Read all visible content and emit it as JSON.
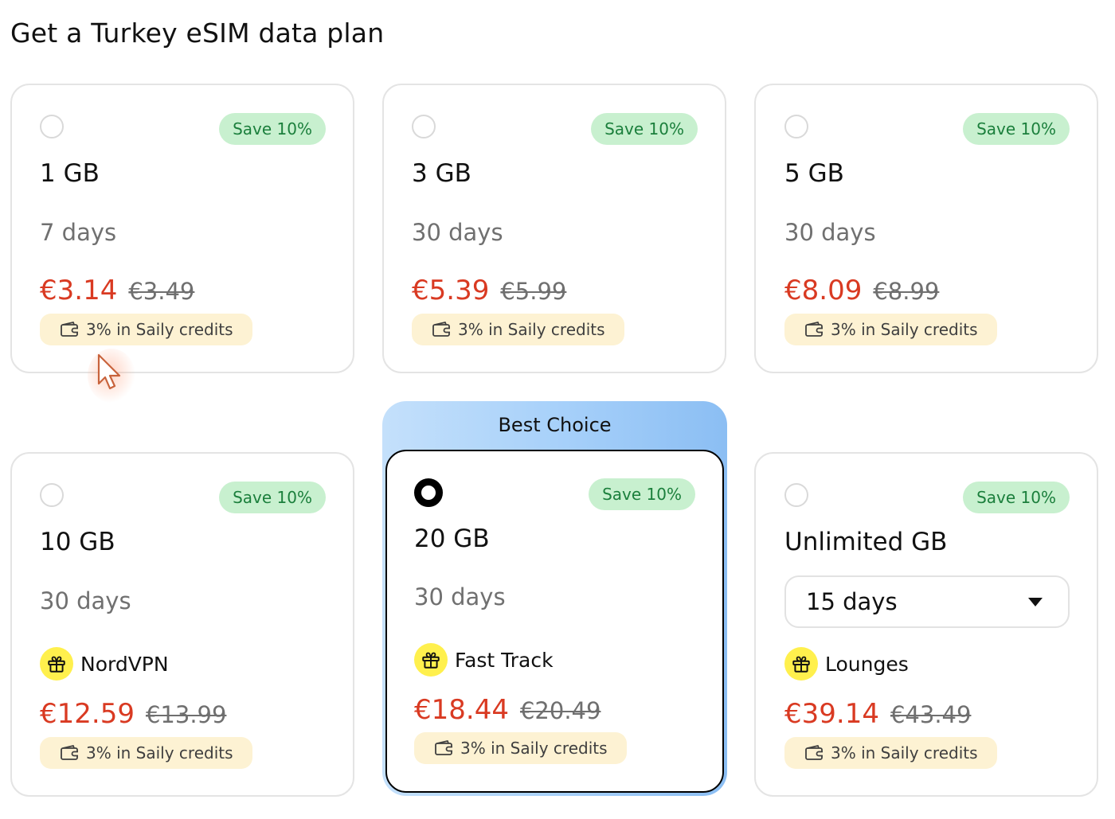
{
  "page": {
    "title": "Get a Turkey eSIM data plan"
  },
  "colors": {
    "price": "#d93a22",
    "save_badge_bg": "#c8f0cf",
    "save_badge_text": "#1b7f3c",
    "credits_bg": "#fdf2d3",
    "perk_icon_bg": "#fff04d",
    "best_choice_gradient": [
      "#c4e0fb",
      "#8bbef3"
    ]
  },
  "plans": [
    {
      "selected": false,
      "badge": "Save 10%",
      "data": "1 GB",
      "duration": "7 days",
      "price": "€3.14",
      "old_price": "€3.49",
      "credits": "3% in Saily credits",
      "credits_icon": "wallet-icon"
    },
    {
      "selected": false,
      "badge": "Save 10%",
      "data": "3 GB",
      "duration": "30 days",
      "price": "€5.39",
      "old_price": "€5.99",
      "credits": "3% in Saily credits",
      "credits_icon": "wallet-icon"
    },
    {
      "selected": false,
      "badge": "Save 10%",
      "data": "5 GB",
      "duration": "30 days",
      "price": "€8.09",
      "old_price": "€8.99",
      "credits": "3% in Saily credits",
      "credits_icon": "wallet-icon"
    },
    {
      "selected": false,
      "badge": "Save 10%",
      "data": "10 GB",
      "duration": "30 days",
      "perk": "NordVPN",
      "perk_icon": "gift-icon",
      "price": "€12.59",
      "old_price": "€13.99",
      "credits": "3% in Saily credits",
      "credits_icon": "wallet-icon"
    },
    {
      "selected": true,
      "ribbon": "Best Choice",
      "badge": "Save 10%",
      "data": "20 GB",
      "duration": "30 days",
      "perk": "Fast Track",
      "perk_icon": "gift-icon",
      "price": "€18.44",
      "old_price": "€20.49",
      "credits": "3% in Saily credits",
      "credits_icon": "wallet-icon"
    },
    {
      "selected": false,
      "badge": "Save 10%",
      "data": "Unlimited GB",
      "duration_select": "15 days",
      "perk": "Lounges",
      "perk_icon": "gift-icon",
      "price": "€39.14",
      "old_price": "€43.49",
      "credits": "3% in Saily credits",
      "credits_icon": "wallet-icon"
    }
  ]
}
